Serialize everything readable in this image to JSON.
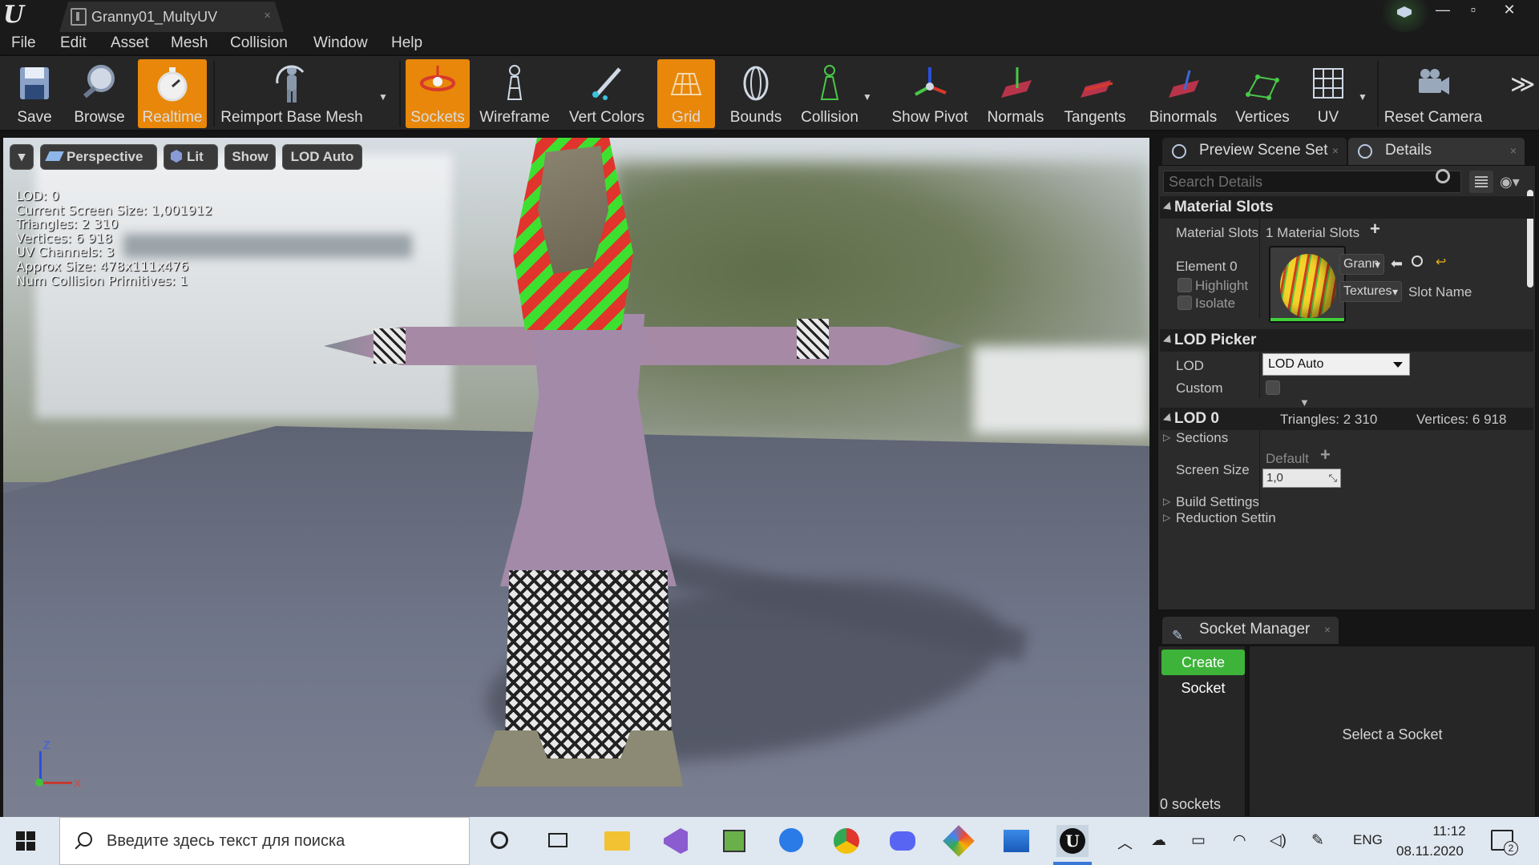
{
  "window": {
    "tab_title": "Granny01_MultyUV",
    "close_glyph": "×",
    "controls": {
      "minimize": "—",
      "maximize": "▫",
      "close": "✕"
    }
  },
  "menu": [
    "File",
    "Edit",
    "Asset",
    "Mesh",
    "Collision",
    "Window",
    "Help"
  ],
  "toolbar": {
    "save": "Save",
    "browse": "Browse",
    "realtime": "Realtime",
    "reimport": "Reimport Base Mesh",
    "sockets": "Sockets",
    "wireframe": "Wireframe",
    "vert_colors": "Vert Colors",
    "grid": "Grid",
    "bounds": "Bounds",
    "collision": "Collision",
    "show_pivot": "Show Pivot",
    "normals": "Normals",
    "tangents": "Tangents",
    "binormals": "Binormals",
    "vertices": "Vertices",
    "uv": "UV",
    "reset_camera": "Reset Camera",
    "more": "≫",
    "active_color": "#e8870a"
  },
  "viewport": {
    "perspective": "Perspective",
    "lit": "Lit",
    "show": "Show",
    "lod": "LOD Auto",
    "stats": [
      "LOD:  0",
      "Current Screen Size:  1,001912",
      "Triangles:  2 310",
      "Vertices:  6 918",
      "UV Channels:  3",
      "Approx Size: 478x111x476",
      "Num Collision Primitives:  1"
    ],
    "axis": {
      "z": "Z",
      "x": "X"
    }
  },
  "panels": {
    "preview_scene_set": "Preview Scene Set",
    "details": "Details",
    "search_placeholder": "Search Details",
    "material_slots": {
      "header": "Material Slots",
      "label": "Material Slots",
      "count": "1 Material Slots",
      "element": "Element 0",
      "highlight": "Highlight",
      "isolate": "Isolate",
      "material_value": "Grann",
      "textures": "Textures",
      "slot_name": "Slot Name"
    },
    "lod_picker": {
      "header": "LOD Picker",
      "lod_label": "LOD",
      "lod_value": "LOD Auto",
      "custom_label": "Custom"
    },
    "lod0": {
      "header": "LOD 0",
      "triangles": "Triangles: 2 310",
      "vertices": "Vertices: 6 918",
      "sections": "Sections",
      "screen_size": "Screen Size",
      "default": "Default",
      "screen_size_value": "1,0",
      "build_settings": "Build Settings",
      "reduction_settings": "Reduction Settin"
    },
    "socket_manager": {
      "title": "Socket Manager",
      "create": "Create Socket",
      "count": "0 sockets",
      "placeholder": "Select a Socket"
    }
  },
  "taskbar": {
    "search_placeholder": "Введите здесь текст для поиска",
    "language": "ENG",
    "time": "11:12",
    "date": "08.11.2020",
    "notifications": "2"
  }
}
